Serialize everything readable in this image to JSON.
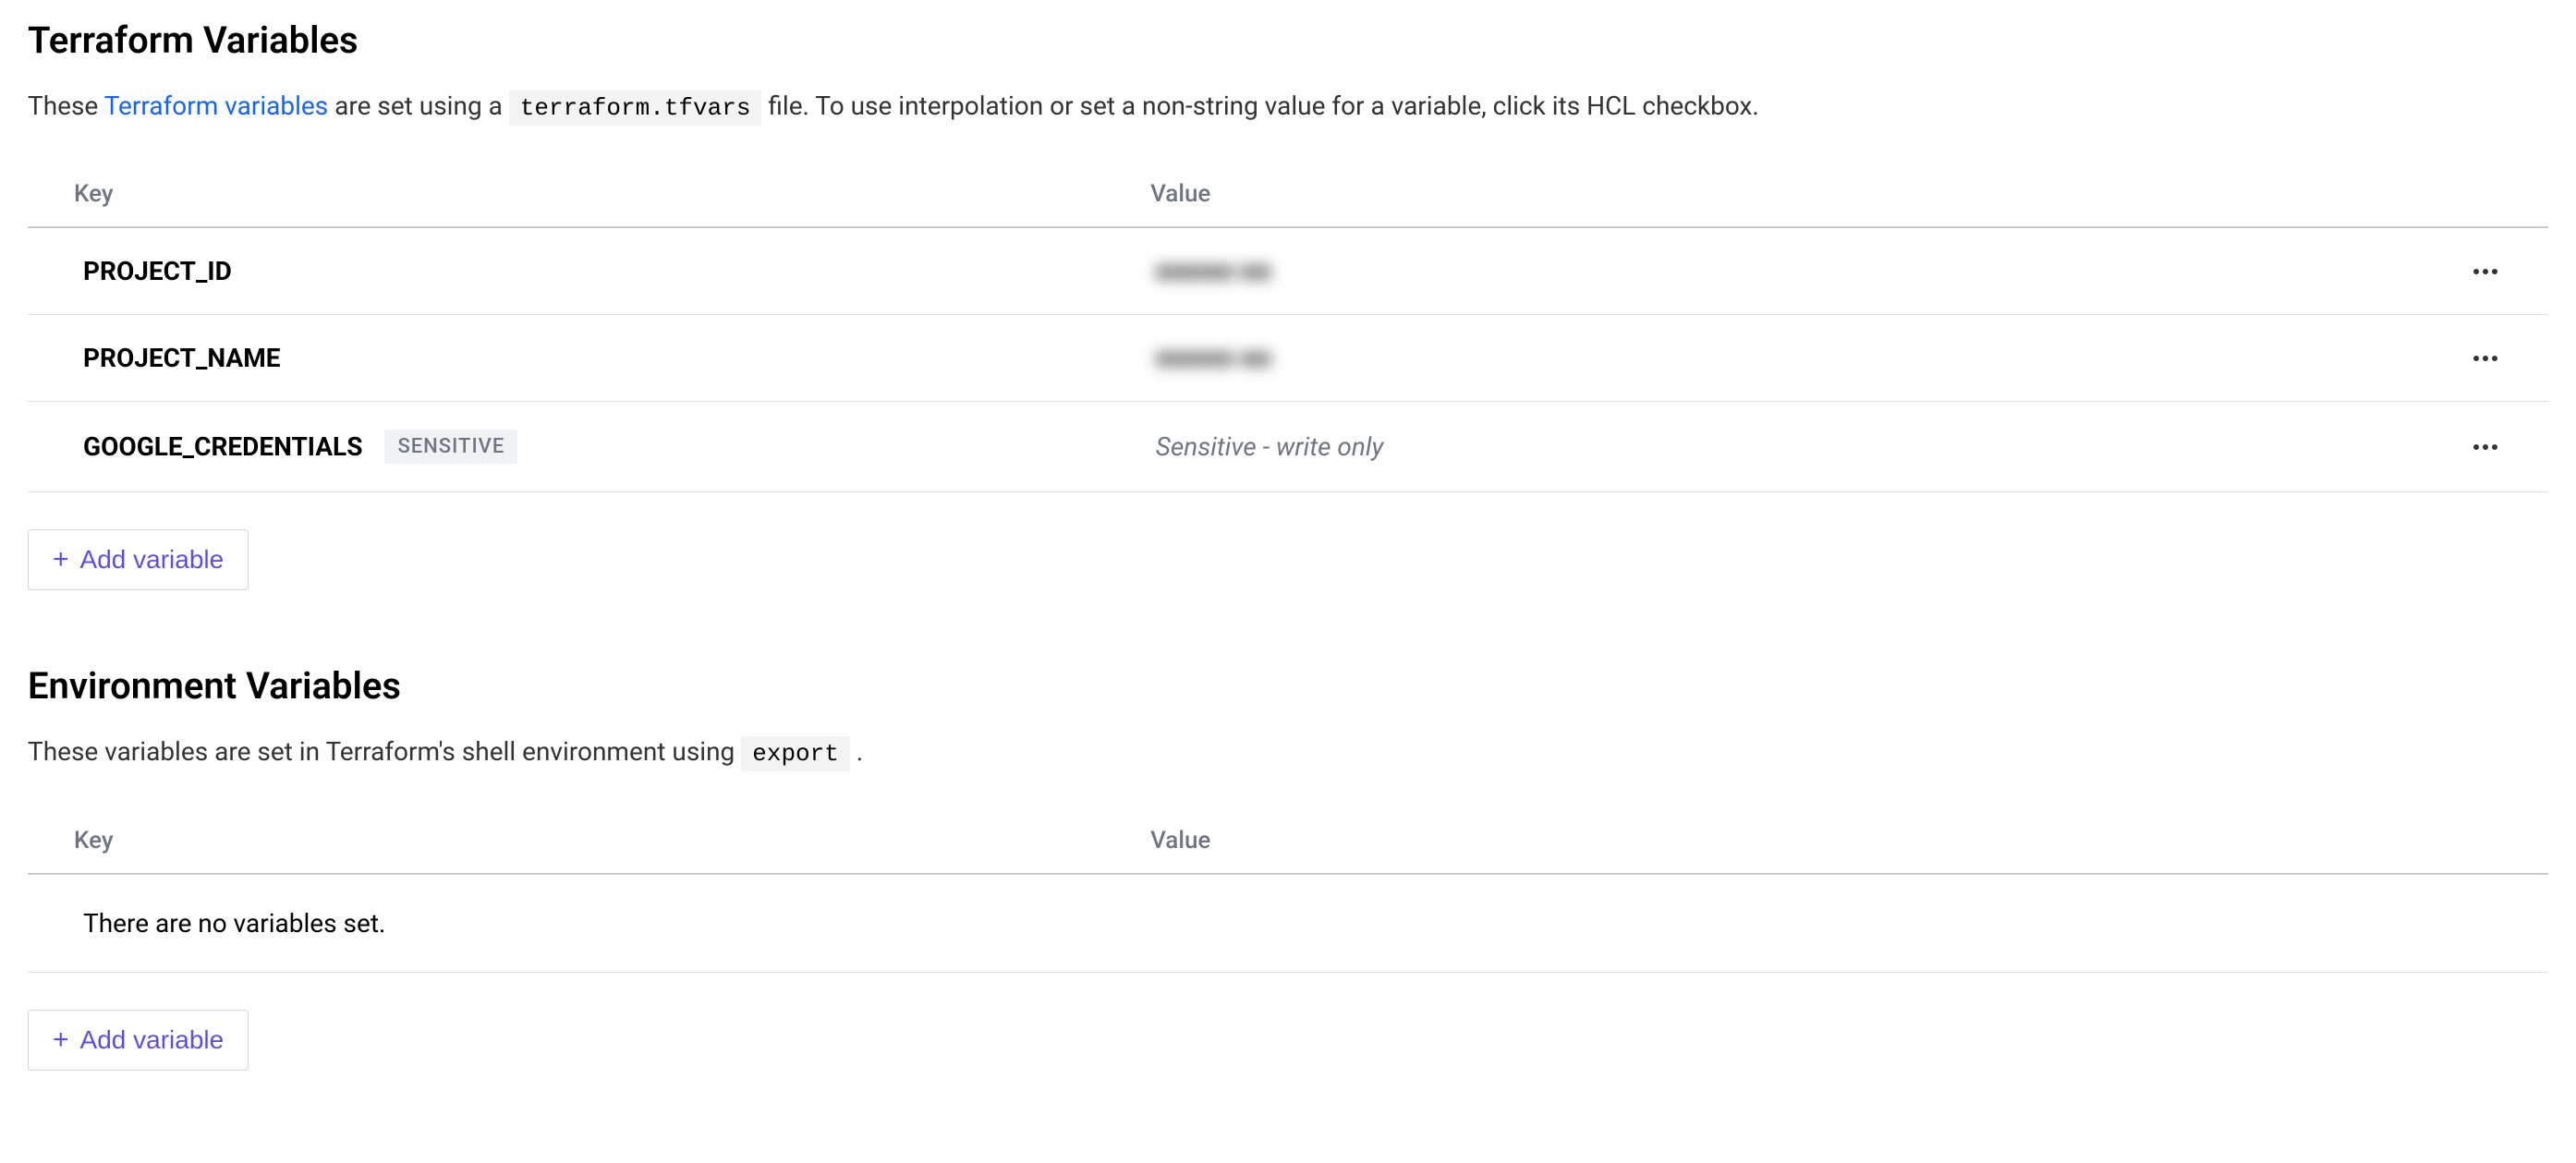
{
  "terraform": {
    "title": "Terraform Variables",
    "desc_prefix": "These ",
    "desc_link": "Terraform variables",
    "desc_mid": " are set using a ",
    "desc_code": "terraform.tfvars",
    "desc_suffix": " file. To use interpolation or set a non-string value for a variable, click its HCL checkbox.",
    "headers": {
      "key": "Key",
      "value": "Value"
    },
    "rows": [
      {
        "key": "PROJECT_ID",
        "value": "■■■■■ ■■",
        "sensitive": false,
        "blurred": true
      },
      {
        "key": "PROJECT_NAME",
        "value": "■■■■■ ■■",
        "sensitive": false,
        "blurred": true
      },
      {
        "key": "GOOGLE_CREDENTIALS",
        "value": "Sensitive - write only",
        "sensitive": true,
        "sensitive_label": "SENSITIVE",
        "blurred": false
      }
    ],
    "add_button": "Add variable"
  },
  "environment": {
    "title": "Environment Variables",
    "desc_prefix": "These variables are set in Terraform's shell environment using ",
    "desc_code": "export",
    "desc_suffix": " .",
    "headers": {
      "key": "Key",
      "value": "Value"
    },
    "empty_text": "There are no variables set.",
    "add_button": "Add variable"
  }
}
